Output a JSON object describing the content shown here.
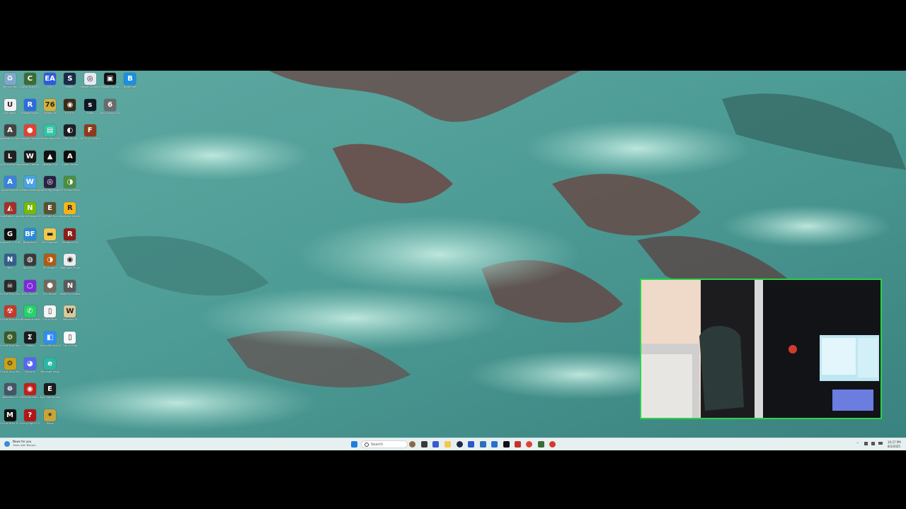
{
  "desktop": {
    "icons": [
      {
        "label": "Recycle Bin",
        "icon": "recycle-bin-icon",
        "color": "#7fa7c9",
        "glyph": "♻"
      },
      {
        "label": "Call of Duty® M...",
        "icon": "call-of-duty-icon",
        "color": "#3d6b35",
        "glyph": "C"
      },
      {
        "label": "EA",
        "icon": "ea-icon",
        "color": "#2f5be0",
        "glyph": "EA"
      },
      {
        "label": "Steam",
        "icon": "steam-icon",
        "color": "#1b2a48",
        "glyph": "S"
      },
      {
        "label": "Ubisoft Connect",
        "icon": "ubisoft-icon",
        "color": "#e8e8f0",
        "glyph": "◎"
      },
      {
        "label": "Roblox Studio",
        "icon": "roblox-studio-icon",
        "color": "#111",
        "glyph": "▣"
      },
      {
        "label": "Battle.net",
        "icon": "battlenet-icon",
        "color": "#1a8fe3",
        "glyph": "B"
      },
      {
        "label": "UnEngine",
        "icon": "unreal-engine-icon",
        "color": "#f2f2f2",
        "glyph": "U"
      },
      {
        "label": "Roblox Player",
        "icon": "roblox-player-icon",
        "color": "#2d6ce0",
        "glyph": "R"
      },
      {
        "label": "Fallout 76",
        "icon": "fallout-icon",
        "color": "#d4b23a",
        "glyph": "76"
      },
      {
        "label": "R.E.P.O.",
        "icon": "repo-icon",
        "color": "#3a2a16",
        "glyph": "◉"
      },
      {
        "label": "Stake",
        "icon": "stake-icon",
        "color": "#0f1923",
        "glyph": "s"
      },
      {
        "label": "Tom Clancy's Rainbow Si...",
        "icon": "rainbow-six-icon",
        "color": "#6b6b6b",
        "glyph": "6"
      },
      {
        "label": "Assassin's Creed Band...",
        "icon": "assassins-creed-icon",
        "color": "#444",
        "glyph": "A"
      },
      {
        "label": "Google Chrome",
        "icon": "chrome-icon",
        "color": "#e34133",
        "glyph": "●"
      },
      {
        "label": "Streamlabs Desktop",
        "icon": "streamlabs-icon",
        "color": "#31c3a2",
        "glyph": "▤"
      },
      {
        "label": "OBS Studio",
        "icon": "obs-icon",
        "color": "#1d1f22",
        "glyph": "◐"
      },
      {
        "label": "Far Cry 2 Fortune's...",
        "icon": "far-cry-icon",
        "color": "#8c3b1c",
        "glyph": "F"
      },
      {
        "label": "LDK License Manager",
        "icon": "ldk-icon",
        "color": "#222",
        "glyph": "L"
      },
      {
        "label": "Waves Central",
        "icon": "waves-icon",
        "color": "#1a1a1a",
        "glyph": "W"
      },
      {
        "label": "Ableton Live",
        "icon": "ableton-icon",
        "color": "#111",
        "glyph": "▲"
      },
      {
        "label": "Audio Center",
        "icon": "audio-center-icon",
        "color": "#0e0e0e",
        "glyph": "A"
      },
      {
        "label": "Aqua Remote",
        "icon": "aqua-icon",
        "color": "#3a84d8",
        "glyph": "A"
      },
      {
        "label": "Webex Meetings",
        "icon": "webex-icon",
        "color": "#4aa3e8",
        "glyph": "W"
      },
      {
        "label": "Samsung Magician",
        "icon": "samsung-icon",
        "color": "#2a2244",
        "glyph": "◎"
      },
      {
        "label": "RT Ghost Prime",
        "icon": "ghost-icon",
        "color": "#4c8d3f",
        "glyph": "◑"
      },
      {
        "label": "Cod Battle Organizer",
        "icon": "cod-organizer-icon",
        "color": "#a0312a",
        "glyph": "◭"
      },
      {
        "label": "Game Bridge M...",
        "icon": "nvidia-icon",
        "color": "#76b900",
        "glyph": "N"
      },
      {
        "label": "The Elder Scro...",
        "icon": "elder-scrolls-icon",
        "color": "#5a5030",
        "glyph": "E"
      },
      {
        "label": "Rockstar Games...",
        "icon": "rockstar-icon",
        "color": "#f4b51c",
        "glyph": "R"
      },
      {
        "label": "Logitech G HUB",
        "icon": "logitech-icon",
        "color": "#111",
        "glyph": "G"
      },
      {
        "label": "BattleField",
        "icon": "battlefield-icon",
        "color": "#2a8ad4",
        "glyph": "BF"
      },
      {
        "label": "File Explorer",
        "icon": "folder-icon",
        "color": "#f2c94c",
        "glyph": "▬"
      },
      {
        "label": "Resident Evil",
        "icon": "resident-evil-icon",
        "color": "#8a1f18",
        "glyph": "R"
      },
      {
        "label": "Neo",
        "icon": "neo-icon",
        "color": "#355f8a",
        "glyph": "N"
      },
      {
        "label": "Dark Sun...",
        "icon": "dark-game-icon",
        "color": "#3a3a3a",
        "glyph": "◍"
      },
      {
        "label": "RT Ghost 2",
        "icon": "ghost-2-icon",
        "color": "#b35a12",
        "glyph": "◑"
      },
      {
        "label": "Wallpaper Engine",
        "icon": "wallpaper-engine-icon",
        "color": "#ececec",
        "glyph": "◉"
      },
      {
        "label": "Call of Duty Black Ops",
        "icon": "cod-black-ops-icon",
        "color": "#2a2a2a",
        "glyph": "☠"
      },
      {
        "label": "DOS GALAXY",
        "icon": "galaxy-icon",
        "color": "#7c2bd6",
        "glyph": "○"
      },
      {
        "label": "Fun House",
        "icon": "fun-house-icon",
        "color": "#726a5a",
        "glyph": "⬢"
      },
      {
        "label": "Need For Speed...",
        "icon": "nfs-icon",
        "color": "#5a5a5a",
        "glyph": "N"
      },
      {
        "label": "Call of Duty Black Ops...",
        "icon": "cod-bo-icon",
        "color": "#c43a2a",
        "glyph": "☢"
      },
      {
        "label": "WhatsApp Web",
        "icon": "whatsapp-icon",
        "color": "#25d366",
        "glyph": "✆"
      },
      {
        "label": "Call of Duty",
        "icon": "document-icon",
        "color": "#f4f4f4",
        "glyph": "▯"
      },
      {
        "label": "Warzone_B",
        "icon": "warzone-icon",
        "color": "#d9c89a",
        "glyph": "W"
      },
      {
        "label": "Call of Duty Modern...",
        "icon": "cod-mw-icon",
        "color": "#3b5b2a",
        "glyph": "⚙"
      },
      {
        "label": "Carbon",
        "icon": "carbon-icon",
        "color": "#1c1c1c",
        "glyph": "Σ"
      },
      {
        "label": "Zoom Medical Software",
        "icon": "zoom-icon",
        "color": "#2d8cff",
        "glyph": "◧"
      },
      {
        "label": "Call of Duty",
        "icon": "file-icon",
        "color": "#f8f8f8",
        "glyph": "▯"
      },
      {
        "label": "Call of Duty Modern...",
        "icon": "cod-mw2-icon",
        "color": "#caa21e",
        "glyph": "⚙"
      },
      {
        "label": "Discord",
        "icon": "discord-icon",
        "color": "#5865f2",
        "glyph": "◕"
      },
      {
        "label": "Microsoft Edge",
        "icon": "edge-icon",
        "color": "#2cb7a5",
        "glyph": "e"
      },
      {
        "label": "Wasteland 3",
        "icon": "wasteland-icon",
        "color": "#445566",
        "glyph": "☸"
      },
      {
        "label": "DRAGON BALL...",
        "icon": "dragon-ball-icon",
        "color": "#c0201c",
        "glyph": "◉"
      },
      {
        "label": "Epic Games Launcher",
        "icon": "epic-games-icon",
        "color": "#1b1b1b",
        "glyph": "E"
      },
      {
        "label": "Call of Duty ®...",
        "icon": "cod-mwiii-icon",
        "color": "#111",
        "glyph": "M"
      },
      {
        "label": "Dying Light 2 Reloaded Ed...",
        "icon": "dying-light-icon",
        "color": "#b0171a",
        "glyph": "?"
      },
      {
        "label": "Kingz",
        "icon": "kingz-icon",
        "color": "#c9a43a",
        "glyph": "✶"
      }
    ]
  },
  "taskbar": {
    "news_title": "News for you",
    "news_sub": "Taken with Bengal...",
    "search_placeholder": "Search",
    "time": "10:27 PM",
    "date": "8/3/2025"
  }
}
